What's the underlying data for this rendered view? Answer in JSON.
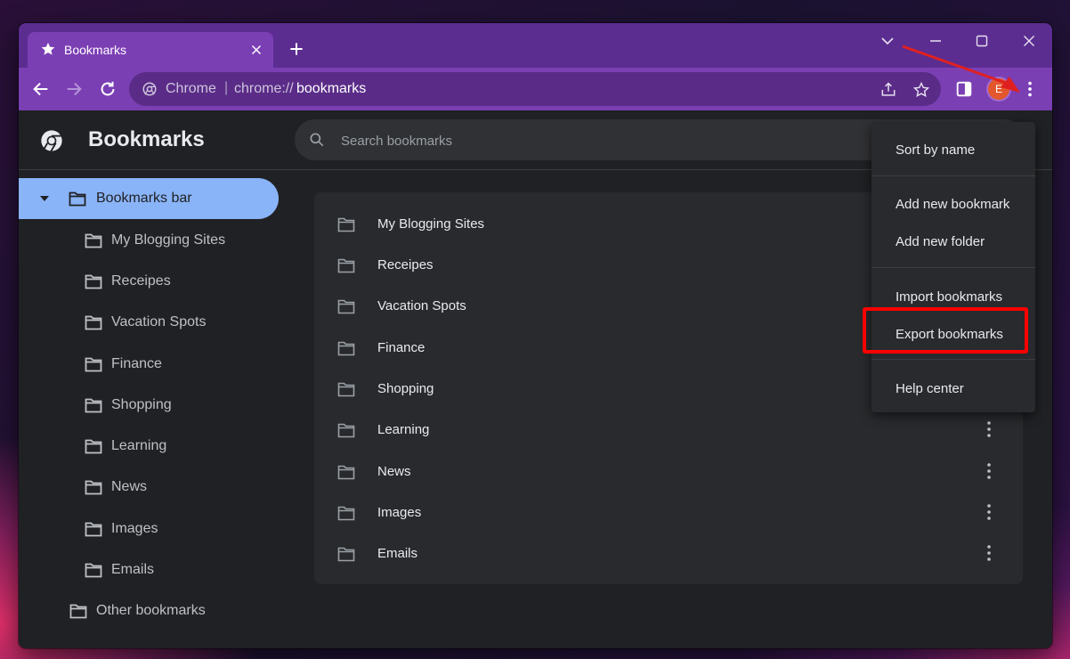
{
  "tab": {
    "title": "Bookmarks"
  },
  "omnibox": {
    "site_label": "Chrome",
    "separator": "|",
    "url_scheme": "chrome://",
    "url_host": "bookmarks"
  },
  "profile": {
    "initial": "E"
  },
  "header": {
    "title": "Bookmarks",
    "search_placeholder": "Search bookmarks"
  },
  "sidebar": {
    "root": "Bookmarks bar",
    "items": [
      "My Blogging Sites",
      "Receipes",
      "Vacation Spots",
      "Finance",
      "Shopping",
      "Learning",
      "News",
      "Images",
      "Emails"
    ],
    "other": "Other bookmarks"
  },
  "list": {
    "items": [
      "My Blogging Sites",
      "Receipes",
      "Vacation Spots",
      "Finance",
      "Shopping",
      "Learning",
      "News",
      "Images",
      "Emails"
    ]
  },
  "menu": {
    "items": [
      "Sort by name",
      "Add new bookmark",
      "Add new folder",
      "Import bookmarks",
      "Export bookmarks",
      "Help center"
    ]
  },
  "colors": {
    "titlebar": "#5c2d91",
    "toolbar": "#7b3fb4",
    "selection": "#8ab4f8",
    "annotation": "#ff0000"
  },
  "icons": [
    "star-icon",
    "close-icon",
    "plus-icon",
    "chevron-down-icon",
    "minimize-icon",
    "maximize-icon",
    "back-icon",
    "forward-icon",
    "reload-icon",
    "chrome-icon",
    "share-icon",
    "bookmark-star-icon",
    "side-panel-icon",
    "kebab-menu-icon",
    "search-icon",
    "folder-icon"
  ]
}
